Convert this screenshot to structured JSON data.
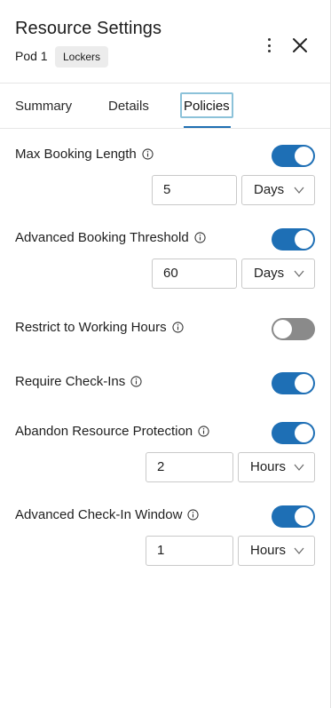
{
  "header": {
    "title": "Resource Settings",
    "subtitle": "Pod 1",
    "tag": "Lockers"
  },
  "tabs": [
    {
      "label": "Summary",
      "active": false
    },
    {
      "label": "Details",
      "active": false
    },
    {
      "label": "Policies",
      "active": true
    }
  ],
  "policies": [
    {
      "label": "Max Booking Length",
      "enabled": true,
      "value": "5",
      "unit": "Days"
    },
    {
      "label": "Advanced Booking Threshold",
      "enabled": true,
      "value": "60",
      "unit": "Days"
    },
    {
      "label": "Restrict to Working Hours",
      "enabled": false
    },
    {
      "label": "Require Check-Ins",
      "enabled": true
    },
    {
      "label": "Abandon Resource Protection",
      "enabled": true,
      "value": "2",
      "unit": "Hours"
    },
    {
      "label": "Advanced Check-In Window",
      "enabled": true,
      "value": "1",
      "unit": "Hours"
    }
  ],
  "colors": {
    "toggle_on": "#1e6fb5",
    "toggle_off": "#8a8a8a",
    "tab_focus": "#8cc2d9"
  },
  "icons": {
    "more": "kebab-icon",
    "close": "close-icon",
    "info": "info-icon",
    "dropdown": "chevron-down-icon"
  }
}
